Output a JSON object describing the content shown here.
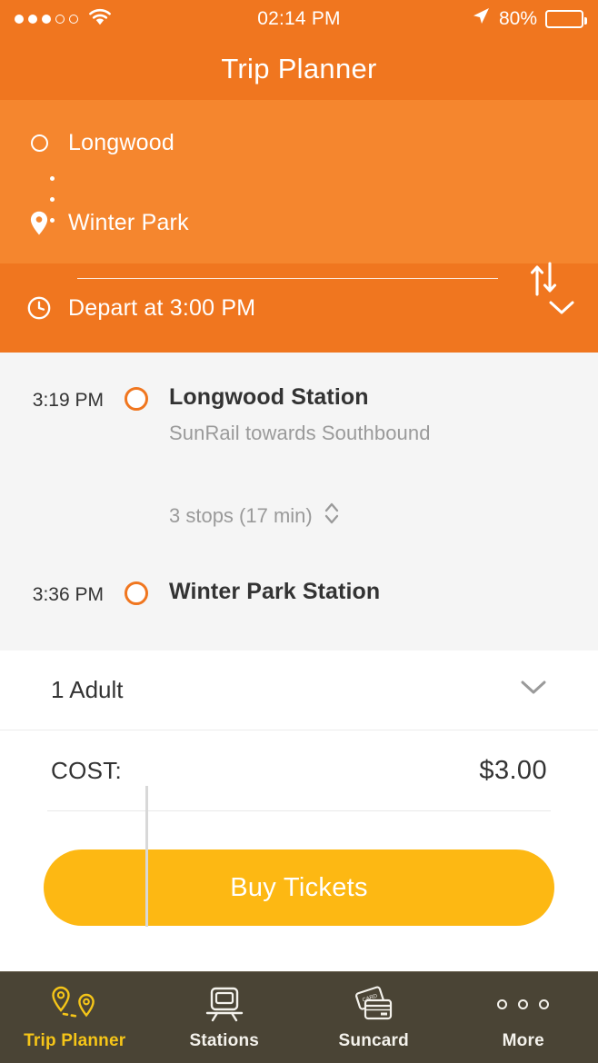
{
  "status_bar": {
    "signal_dots_filled": 3,
    "signal_dots_total": 5,
    "wifi_icon": "wifi-icon",
    "time": "02:14 PM",
    "location_icon": "location-arrow-icon",
    "battery_percent": "80%",
    "battery_level": 80
  },
  "header": {
    "title": "Trip Planner",
    "background_color": "#F0761F"
  },
  "route": {
    "background_color": "#F5862E",
    "origin": {
      "label": "Longwood",
      "icon": "circle-outline-icon"
    },
    "destination": {
      "label": "Winter Park",
      "icon": "map-pin-icon"
    },
    "swap_icon": "swap-vertical-arrows-icon"
  },
  "depart": {
    "clock_icon": "clock-icon",
    "label": "Depart at 3:00 PM",
    "chevron_icon": "chevron-down-icon"
  },
  "itinerary": {
    "background_color": "#F5F5F5",
    "marker_color": "#F0761F",
    "legs": [
      {
        "time": "3:19 PM",
        "station": "Longwood Station",
        "route_detail": "SunRail towards Southbound"
      },
      {
        "time": "3:36 PM",
        "station": "Winter Park Station",
        "route_detail": ""
      }
    ],
    "stops_summary": "3 stops (17 min)",
    "stops_expand_icon": "chevron-up-down-icon"
  },
  "passengers": {
    "label": "1 Adult",
    "chevron_icon": "chevron-down-icon"
  },
  "cost": {
    "label": "COST:",
    "value": "$3.00"
  },
  "buy_button": {
    "label": "Buy Tickets",
    "color": "#FDB813"
  },
  "tabbar": {
    "background_color": "#4A4435",
    "active_color": "#F5C518",
    "items": [
      {
        "label": "Trip Planner",
        "icon": "map-pins-route-icon",
        "active": true
      },
      {
        "label": "Stations",
        "icon": "train-icon",
        "active": false
      },
      {
        "label": "Suncard",
        "icon": "credit-cards-icon",
        "active": false
      },
      {
        "label": "More",
        "icon": "ellipsis-icon",
        "active": false
      }
    ]
  }
}
